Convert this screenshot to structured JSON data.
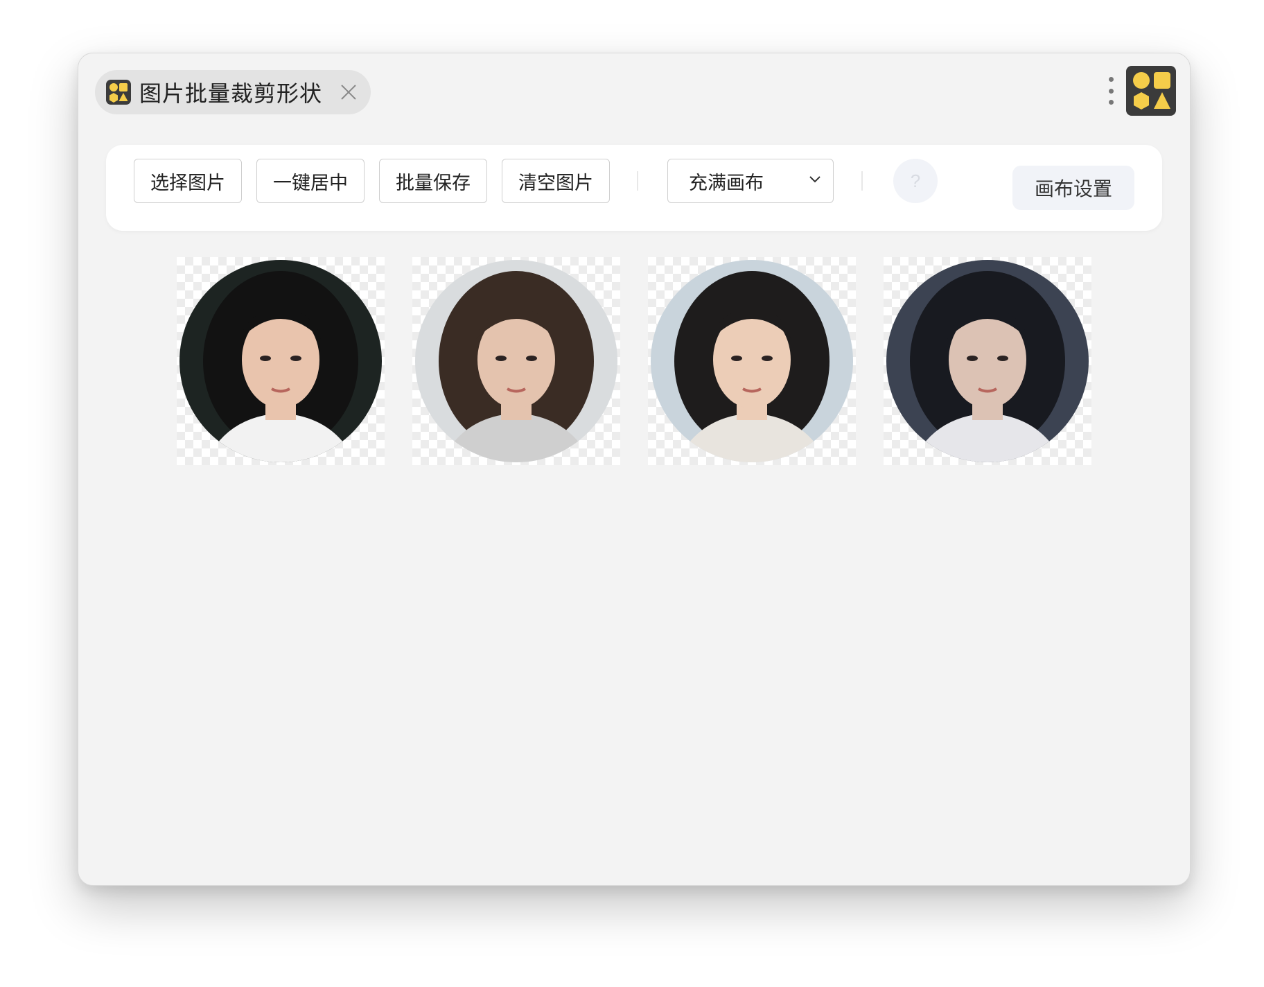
{
  "tab": {
    "title": "图片批量裁剪形状",
    "icon": "app-shapes-icon",
    "close_icon": "close-icon"
  },
  "header": {
    "more_icon": "more-vertical-icon",
    "app_icon": "app-shapes-icon"
  },
  "toolbar": {
    "select_images": "选择图片",
    "center_all": "一键居中",
    "batch_save": "批量保存",
    "clear_images": "清空图片",
    "fit_mode": {
      "value": "充满画布",
      "options": [
        "充满画布"
      ]
    },
    "help": "?",
    "canvas_settings": "画布设置"
  },
  "images": [
    {
      "name": "portrait-1",
      "shape": "circle",
      "palette": {
        "bg": "#1d2422",
        "skin": "#e9c4ad",
        "hair": "#121212",
        "cloth": "#f2f2f2"
      }
    },
    {
      "name": "portrait-2",
      "shape": "circle",
      "palette": {
        "bg": "#d9dcde",
        "skin": "#e4c3ae",
        "hair": "#3a2c24",
        "cloth": "#cfcfcf"
      }
    },
    {
      "name": "portrait-3",
      "shape": "circle",
      "palette": {
        "bg": "#c9d4dc",
        "skin": "#eccdb7",
        "hair": "#1e1c1c",
        "cloth": "#e8e4de"
      }
    },
    {
      "name": "portrait-4",
      "shape": "circle",
      "palette": {
        "bg": "#3c4352",
        "skin": "#dcc2b4",
        "hair": "#181a20",
        "cloth": "#e6e6ea"
      }
    }
  ],
  "colors": {
    "window_bg": "#f3f3f3",
    "icon_yellow": "#f5cd4a",
    "icon_dark": "#3b3b3b"
  }
}
